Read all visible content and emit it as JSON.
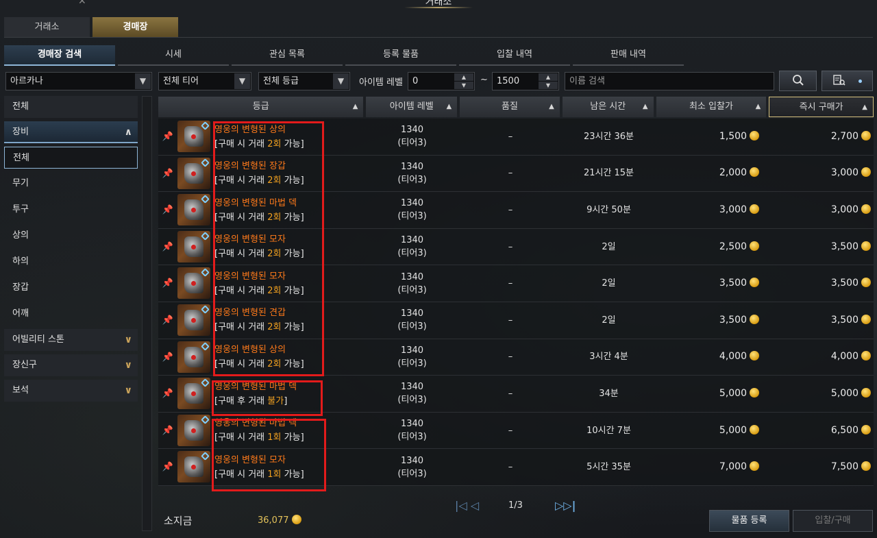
{
  "window": {
    "title": "거래소"
  },
  "top_tabs": [
    {
      "label": "거래소"
    },
    {
      "label": "경매장"
    }
  ],
  "sub_tabs": [
    {
      "label": "경매장 검색"
    },
    {
      "label": "시세"
    },
    {
      "label": "관심 목록"
    },
    {
      "label": "등록 물품"
    },
    {
      "label": "입찰 내역"
    },
    {
      "label": "판매 내역"
    }
  ],
  "filters": {
    "class_select": "아르카나",
    "tier_select": "전체 티어",
    "grade_select": "전체 등급",
    "level_label": "아이템 레벨",
    "level_min": "0",
    "level_sep": "~",
    "level_max": "1500",
    "name_placeholder": "이름 검색"
  },
  "sidebar": {
    "all": "전체",
    "equipment": "장비",
    "equipment_items": [
      "전체",
      "무기",
      "투구",
      "상의",
      "하의",
      "장갑",
      "어깨"
    ],
    "ability_stone": "어빌리티 스톤",
    "accessory": "장신구",
    "gem": "보석"
  },
  "columns": [
    "등급",
    "아이템 레벨",
    "품질",
    "남은 시간",
    "최소 입찰가",
    "즉시 구매가"
  ],
  "rows": [
    {
      "name": "영웅의 변형된 상의",
      "trade_pre": "[구매 시 거래 ",
      "trade_hl": "2회",
      "trade_post": " 가능]",
      "level": "1340",
      "tier": "(티어3)",
      "quality": "–",
      "time": "23시간 36분",
      "bid": "1,500",
      "buy": "2,700"
    },
    {
      "name": "영웅의 변형된 장갑",
      "trade_pre": "[구매 시 거래 ",
      "trade_hl": "2회",
      "trade_post": " 가능]",
      "level": "1340",
      "tier": "(티어3)",
      "quality": "–",
      "time": "21시간 15분",
      "bid": "2,000",
      "buy": "3,000"
    },
    {
      "name": "영웅의 변형된 마법 덱",
      "trade_pre": "[구매 시 거래 ",
      "trade_hl": "2회",
      "trade_post": " 가능]",
      "level": "1340",
      "tier": "(티어3)",
      "quality": "–",
      "time": "9시간 50분",
      "bid": "3,000",
      "buy": "3,000"
    },
    {
      "name": "영웅의 변형된 모자",
      "trade_pre": "[구매 시 거래 ",
      "trade_hl": "2회",
      "trade_post": " 가능]",
      "level": "1340",
      "tier": "(티어3)",
      "quality": "–",
      "time": "2일",
      "bid": "2,500",
      "buy": "3,500"
    },
    {
      "name": "영웅의 변형된 모자",
      "trade_pre": "[구매 시 거래 ",
      "trade_hl": "2회",
      "trade_post": " 가능]",
      "level": "1340",
      "tier": "(티어3)",
      "quality": "–",
      "time": "2일",
      "bid": "3,500",
      "buy": "3,500"
    },
    {
      "name": "영웅의 변형된 견갑",
      "trade_pre": "[구매 시 거래 ",
      "trade_hl": "2회",
      "trade_post": " 가능]",
      "level": "1340",
      "tier": "(티어3)",
      "quality": "–",
      "time": "2일",
      "bid": "3,500",
      "buy": "3,500"
    },
    {
      "name": "영웅의 변형된 상의",
      "trade_pre": "[구매 시 거래 ",
      "trade_hl": "2회",
      "trade_post": " 가능]",
      "level": "1340",
      "tier": "(티어3)",
      "quality": "–",
      "time": "3시간 4분",
      "bid": "4,000",
      "buy": "4,000"
    },
    {
      "name": "영웅의 변형된 마법 덱",
      "trade_pre": "[구매 후 거래 ",
      "trade_hl": "불가",
      "trade_post": "]",
      "level": "1340",
      "tier": "(티어3)",
      "quality": "–",
      "time": "34분",
      "bid": "5,000",
      "buy": "5,000"
    },
    {
      "name": "영웅의 변형된 마법 덱",
      "trade_pre": "[구매 시 거래 ",
      "trade_hl": "1회",
      "trade_post": " 가능]",
      "level": "1340",
      "tier": "(티어3)",
      "quality": "–",
      "time": "10시간 7분",
      "bid": "5,000",
      "buy": "6,500"
    },
    {
      "name": "영웅의 변형된 모자",
      "trade_pre": "[구매 시 거래 ",
      "trade_hl": "1회",
      "trade_post": " 가능]",
      "level": "1340",
      "tier": "(티어3)",
      "quality": "–",
      "time": "5시간 35분",
      "bid": "7,000",
      "buy": "7,500"
    }
  ],
  "pagination": {
    "text": "1/3",
    "prev": "|◁ ◁",
    "next": "▷▷|"
  },
  "footer": {
    "money_label": "소지금",
    "money_value": "36,077",
    "register_btn": "물품 등록",
    "bid_buy_btn": "입찰/구매"
  },
  "colors": {
    "accent": "#8fb7d8",
    "item_name": "#ff7a1a",
    "highlight_box": "#e31b1b",
    "gold": "#e3c25a"
  }
}
